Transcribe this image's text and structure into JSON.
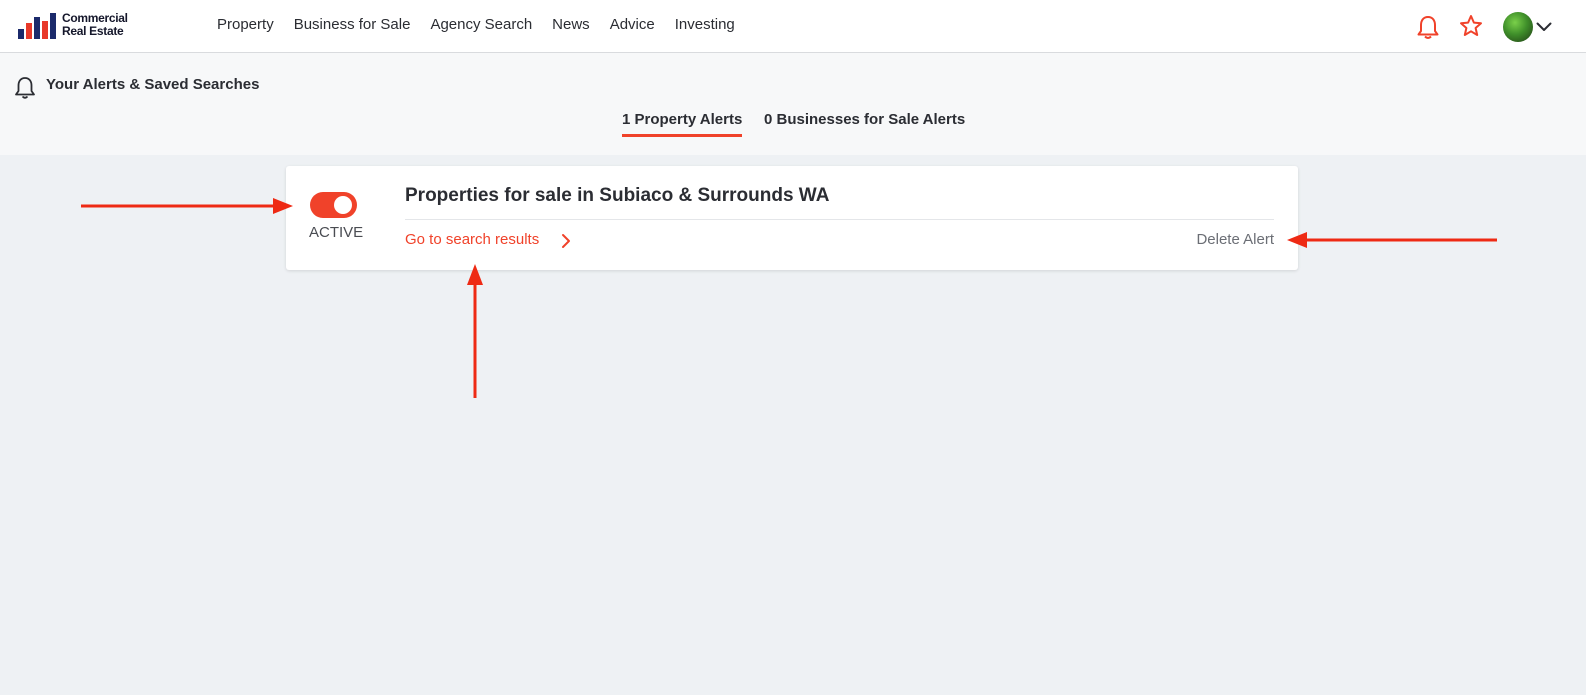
{
  "header": {
    "logo_line1": "Commercial",
    "logo_line2": "Real Estate",
    "nav": [
      "Property",
      "Business for Sale",
      "Agency Search",
      "News",
      "Advice",
      "Investing"
    ],
    "icons": [
      "bell-icon",
      "star-icon",
      "avatar",
      "chevron-down-icon"
    ]
  },
  "alerts": {
    "title": "Your Alerts & Saved Searches",
    "tabs": [
      {
        "label": "1 Property Alerts",
        "active": true
      },
      {
        "label": "0 Businesses for Sale Alerts",
        "active": false
      }
    ]
  },
  "card": {
    "status": "ACTIVE",
    "toggle_on": true,
    "title": "Properties for sale in Subiaco & Surrounds WA",
    "link": "Go to search results",
    "delete": "Delete Alert"
  },
  "colors": {
    "accent": "#f0422a",
    "annotation": "#ee2a14",
    "page_bg": "#eef1f4"
  }
}
